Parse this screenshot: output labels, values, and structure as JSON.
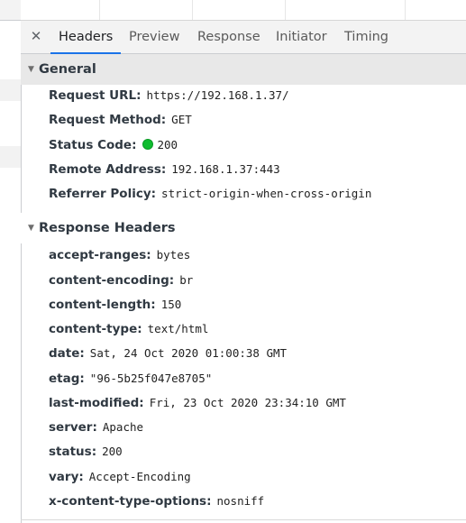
{
  "tabs": [
    {
      "label": "Headers",
      "active": true
    },
    {
      "label": "Preview",
      "active": false
    },
    {
      "label": "Response",
      "active": false
    },
    {
      "label": "Initiator",
      "active": false
    },
    {
      "label": "Timing",
      "active": false
    }
  ],
  "close_glyph": "✕",
  "general": {
    "title": "General",
    "rows": [
      {
        "key": "Request URL:",
        "value": "https://192.168.1.37/"
      },
      {
        "key": "Request Method:",
        "value": "GET"
      },
      {
        "key": "Status Code:",
        "value": "200",
        "status_color": "#0fbc2f"
      },
      {
        "key": "Remote Address:",
        "value": "192.168.1.37:443"
      },
      {
        "key": "Referrer Policy:",
        "value": "strict-origin-when-cross-origin"
      }
    ]
  },
  "response_headers": {
    "title": "Response Headers",
    "rows": [
      {
        "key": "accept-ranges:",
        "value": "bytes"
      },
      {
        "key": "content-encoding:",
        "value": "br"
      },
      {
        "key": "content-length:",
        "value": "150"
      },
      {
        "key": "content-type:",
        "value": "text/html"
      },
      {
        "key": "date:",
        "value": "Sat, 24 Oct 2020 01:00:38 GMT"
      },
      {
        "key": "etag:",
        "value": "\"96-5b25f047e8705\""
      },
      {
        "key": "last-modified:",
        "value": "Fri, 23 Oct 2020 23:34:10 GMT"
      },
      {
        "key": "server:",
        "value": "Apache"
      },
      {
        "key": "status:",
        "value": "200"
      },
      {
        "key": "vary:",
        "value": "Accept-Encoding"
      },
      {
        "key": "x-content-type-options:",
        "value": "nosniff"
      }
    ]
  },
  "colors": {
    "accent": "#1a73e8",
    "status_ok": "#0fbc2f"
  }
}
